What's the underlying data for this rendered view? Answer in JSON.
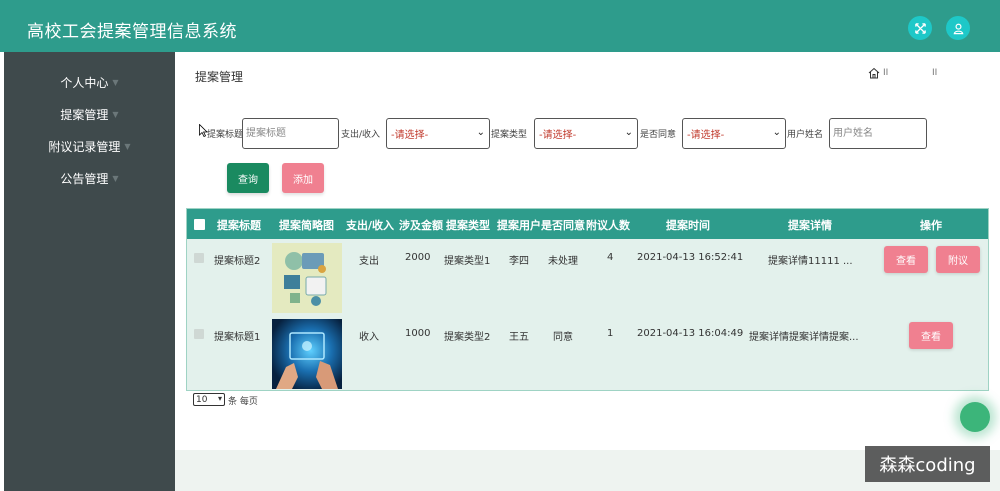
{
  "app": {
    "title": "高校工会提案管理信息系统"
  },
  "header": {
    "icons": [
      "fullscreen-icon",
      "user-icon"
    ],
    "accent": "#2e9c8c",
    "icon_color": "#1ec8c8"
  },
  "sidebar": {
    "items": [
      {
        "label": "个人中心"
      },
      {
        "label": "提案管理"
      },
      {
        "label": "附议记录管理"
      },
      {
        "label": "公告管理"
      }
    ],
    "background": "#3f4a4c"
  },
  "page": {
    "title": "提案管理",
    "breadcrumb_sep": "II"
  },
  "search": {
    "title_label": "提案标题",
    "title_placeholder": "提案标题",
    "io_label": "支出/收入",
    "io_select": "-请选择-",
    "type_label": "提案类型",
    "type_select": "-请选择-",
    "agree_label": "是否同意",
    "agree_select": "-请选择-",
    "user_label": "用户姓名",
    "user_placeholder": "用户姓名"
  },
  "buttons": {
    "query": "查询",
    "add": "添加"
  },
  "table": {
    "columns": [
      "提案标题",
      "提案简略图",
      "支出/收入",
      "涉及金额",
      "提案类型",
      "提案用户",
      "是否同意",
      "附议人数",
      "提案时间",
      "提案详情",
      "操作"
    ],
    "rows": [
      {
        "title": "提案标题2",
        "io": "支出",
        "amount": "2000",
        "type": "提案类型1",
        "user": "李四",
        "agree": "未处理",
        "seconders": "4",
        "time": "2021-04-13 16:52:41",
        "detail": "提案详情11111 ...",
        "actions": [
          "查看",
          "附议"
        ]
      },
      {
        "title": "提案标题1",
        "io": "收入",
        "amount": "1000",
        "type": "提案类型2",
        "user": "王五",
        "agree": "同意",
        "seconders": "1",
        "time": "2021-04-13 16:04:49",
        "detail": "提案详情提案详情提案...",
        "actions": [
          "查看"
        ]
      }
    ]
  },
  "pagination": {
    "page_size": "10",
    "page_size_label": "条 每页"
  },
  "watermark": "森森coding"
}
